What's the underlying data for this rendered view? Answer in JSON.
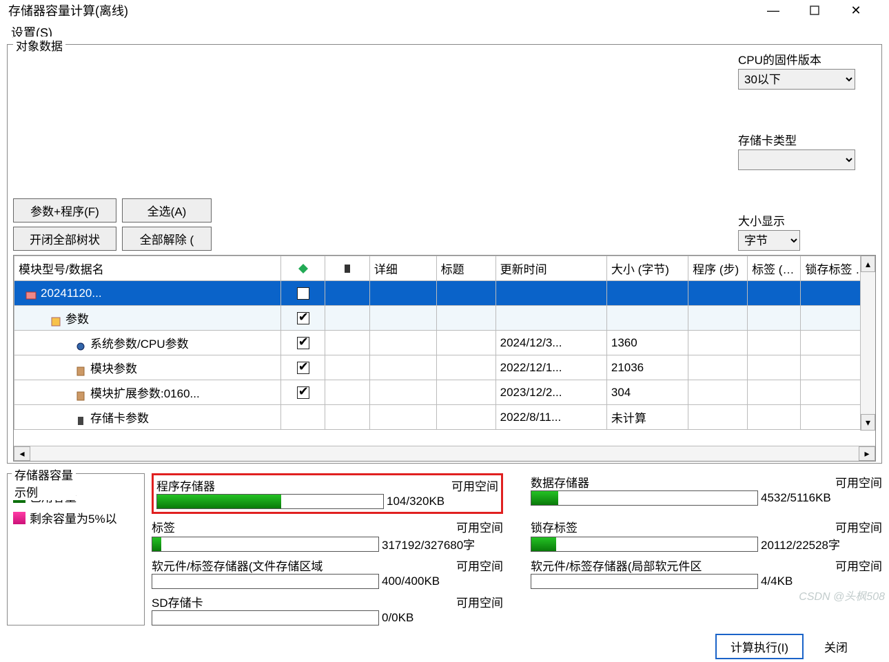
{
  "window": {
    "title": "存储器容量计算(离线)",
    "min": "—",
    "max": "▢",
    "close": "✕"
  },
  "menubar": {
    "settings": "设置(S)"
  },
  "object_data": {
    "title": "对象数据",
    "btn_param_prog": "参数+程序(F)",
    "btn_select_all": "全选(A)",
    "btn_toggle_tree": "开闭全部树状",
    "btn_clear_all": "全部解除 (",
    "cpu_firmware_label": "CPU的固件版本",
    "cpu_firmware_options": [
      "30以下"
    ],
    "cpu_firmware_value": "30以下",
    "card_type_label": "存储卡类型",
    "card_type_value": "",
    "size_disp_label": "大小显示",
    "size_disp_value": "字节"
  },
  "table": {
    "headers": {
      "name": "模块型号/数据名",
      "ic1": "◆",
      "ic2": "▮",
      "detail": "详细",
      "title": "标题",
      "updated": "更新时间",
      "size": "大小 (字节)",
      "prog": "程序 (步)",
      "tag": "标签 (字)",
      "lock": "锁存标签 (字)"
    },
    "rows": [
      {
        "indent": 0,
        "icon": "project-icon",
        "name": "20241120...",
        "chk1": false,
        "chk1_box": true,
        "selected": true
      },
      {
        "indent": 1,
        "icon": "params-icon",
        "name": "参数",
        "chk1": true,
        "after_sel": true
      },
      {
        "indent": 2,
        "icon": "gear-icon",
        "name": "系统参数/CPU参数",
        "chk1": true,
        "updated": "2024/12/3...",
        "size": "1360"
      },
      {
        "indent": 2,
        "icon": "module-icon",
        "name": "模块参数",
        "chk1": true,
        "updated": "2022/12/1...",
        "size": "21036"
      },
      {
        "indent": 2,
        "icon": "module-icon",
        "name": "模块扩展参数:0160...",
        "chk1": true,
        "updated": "2023/12/2...",
        "size": "304"
      },
      {
        "indent": 2,
        "icon": "card-icon",
        "name": "存储卡参数",
        "updated": "2022/8/11...",
        "size": "未计算"
      }
    ]
  },
  "capacity": {
    "legend": {
      "title": "存储器容量\n示例",
      "used": "已用容量",
      "remain_low": "剩余容量为5%以"
    },
    "items": [
      {
        "key": "program",
        "name": "程序存储器",
        "avail_label": "可用空间",
        "value": "104/320KB",
        "fill_pct": 55,
        "highlight": true
      },
      {
        "key": "data",
        "name": "数据存储器",
        "avail_label": "可用空间",
        "value": "4532/5116KB",
        "fill_pct": 12
      },
      {
        "key": "label",
        "name": "标签",
        "avail_label": "可用空间",
        "value": "317192/327680字",
        "fill_pct": 4
      },
      {
        "key": "latch",
        "name": "锁存标签",
        "avail_label": "可用空间",
        "value": "20112/22528字",
        "fill_pct": 11
      },
      {
        "key": "devfile",
        "name": "软元件/标签存储器(文件存储区域",
        "avail_label": "可用空间",
        "value": "400/400KB",
        "fill_pct": 0
      },
      {
        "key": "devloc",
        "name": "软元件/标签存储器(局部软元件区",
        "avail_label": "可用空间",
        "value": "4/4KB",
        "fill_pct": 0
      },
      {
        "key": "sd",
        "name": "SD存储卡",
        "avail_label": "可用空间",
        "value": "0/0KB",
        "fill_pct": 0
      }
    ]
  },
  "footer": {
    "execute": "计算执行(I)",
    "close": "关闭"
  },
  "watermark": "CSDN @头枫508"
}
